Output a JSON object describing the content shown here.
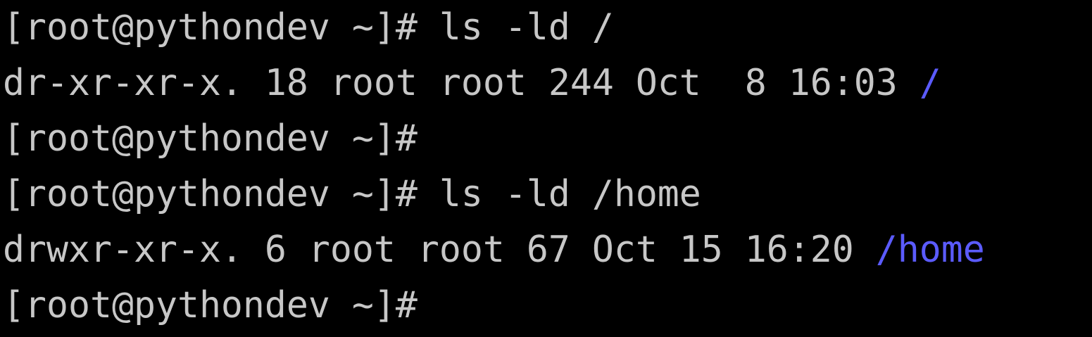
{
  "terminal": {
    "lines": [
      {
        "prompt": "[root@pythondev ~]#",
        "command": " ls -ld /"
      },
      {
        "output": "dr-xr-xr-x. 18 root root 244 Oct  8 16:03 ",
        "dir": "/"
      },
      {
        "prompt": "[root@pythondev ~]#",
        "command": ""
      },
      {
        "prompt": "[root@pythondev ~]#",
        "command": " ls -ld /home"
      },
      {
        "output": "drwxr-xr-x. 6 root root 67 Oct 15 16:20 ",
        "dir": "/home"
      },
      {
        "prompt": "[root@pythondev ~]#",
        "command": ""
      }
    ]
  },
  "colors": {
    "background": "#000000",
    "text": "#c7c7c7",
    "directory": "#5b5bff"
  }
}
